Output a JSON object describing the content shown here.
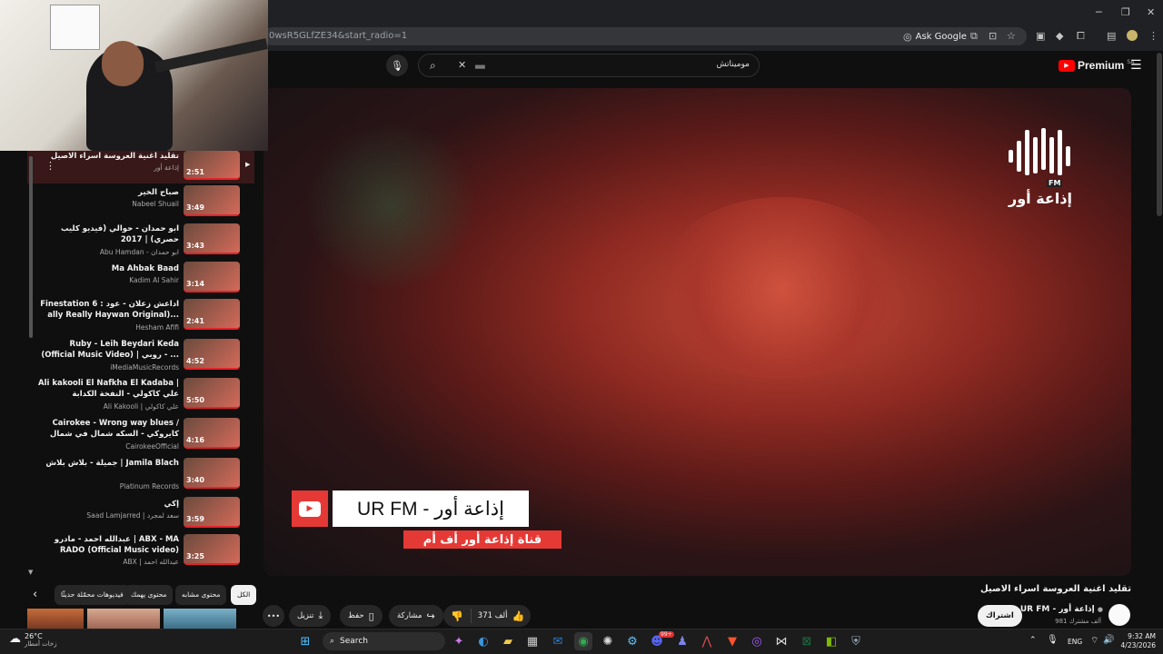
{
  "browser": {
    "url": "0wsR5GLfZE34&start_radio=1",
    "ask_google": "Ask Google"
  },
  "header": {
    "search_value": "موميناتش",
    "search_badge": "▄▄",
    "logo_text": "Premium",
    "logo_sup": "SA"
  },
  "video": {
    "overlay_channel": "UR FM - إذاعة أور",
    "overlay_sub": "قناة إذاعة أور أف أم",
    "logo_main": "إذاعة أور",
    "logo_fm": "FM"
  },
  "playlist": {
    "current": {
      "title": "تقليد اغنية العروسة اسراء الاصيل",
      "channel": "إذاعة أور",
      "duration": "2:51"
    },
    "items": [
      {
        "title": "صباح الخير",
        "channel": "Nabeel Shuail",
        "duration": "3:49"
      },
      {
        "title": "ابو حمدان - حوالي (فيديو كليب حصري) | 2017",
        "channel": "Abu Hamdan - ابو حمدان",
        "duration": "3:43"
      },
      {
        "title": "Ma Ahbak Baad",
        "channel": "Kadim Al Sahir",
        "duration": "3:14"
      },
      {
        "title": "Finestation 6 : اداعش زعلان - عود ally Really Haywan Original)...",
        "channel": "Hesham Afifi",
        "duration": "2:41"
      },
      {
        "title": "Ruby - Leih Beydari Keda (Official Music Video) | روبي - ...",
        "channel": "iMediaMusicRecords",
        "duration": "4:52"
      },
      {
        "title": "Ali kakooli El Nafkha El Kadaba | علي كاكولي - النفخة الكدابة",
        "channel": "Ali Kakooli | علي كاكولي",
        "duration": "5:50"
      },
      {
        "title": "Cairokee - Wrong way blues / كايروكي - السكه شمال في شمال",
        "channel": "CairokeeOfficial",
        "duration": "4:16"
      },
      {
        "title": "جميلة - بلاش بلاش | Jamila Blach",
        "channel": "Platinum Records",
        "duration": "3:40"
      },
      {
        "title": "إكي",
        "channel": "Saad Lamjarred | سعد لمجرد",
        "duration": "3:59"
      },
      {
        "title": "عبدالله احمد - مادرو | ABX - MA RADO (Official Music video)",
        "channel": "ABX | عبدالله احمد",
        "duration": "3:25"
      }
    ]
  },
  "chips": [
    "الكل",
    "محتوى مشابه",
    "محتوى يهمك",
    "فيديوهات محمّلة حديثًا"
  ],
  "meta": {
    "title": "تقليد اغنية العروسة اسراء الاصيل",
    "channel": "UR FM - إذاعة أور",
    "subscribers": "981 ألف مشترك",
    "subscribe": "اشتراك",
    "likes": "371 ألف",
    "share": "مشاركة",
    "save": "حفظ",
    "download": "تنزيل",
    "more": "•••"
  },
  "taskbar": {
    "weather_temp": "26°C",
    "weather_desc": "زخات أمطار",
    "search": "Search",
    "lang": "ENG",
    "time": "9:32 AM",
    "date": "4/23/2026",
    "notif": "99+"
  }
}
